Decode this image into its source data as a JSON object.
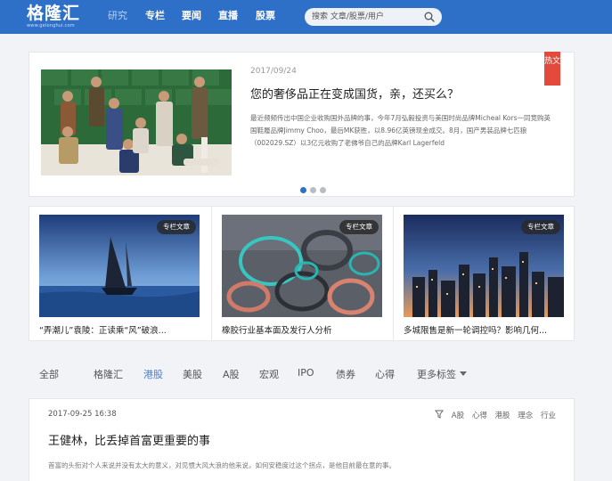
{
  "brand": {
    "name": "格隆汇",
    "domain": "www.gelonghui.com"
  },
  "nav": {
    "items": [
      {
        "label": "研究",
        "active": false
      },
      {
        "label": "专栏",
        "active": true
      },
      {
        "label": "要闻",
        "active": true
      },
      {
        "label": "直播",
        "active": true
      },
      {
        "label": "股票",
        "active": true
      }
    ],
    "search_placeholder": "搜索 文章/股票/用户",
    "search_icon": "search-icon"
  },
  "hero": {
    "date": "2017/09/24",
    "title": "您的奢侈品正在变成国货，亲，还买么？",
    "summary": "最近频频传出中国企业收购国外品牌的事，今年7月弘毅投资与美国时尚品牌Micheal Kors一同竞购英国鞋履品牌Jimmy Choo，最后MK获胜，以8.96亿英镑现金成交。8月，国产男装品牌七匹狼（002029.SZ）以3亿元收购了老佛爷自己的品牌Karl Lagerfeld",
    "badge": "热文",
    "dots_total": 3,
    "dot_active": 0
  },
  "cards": [
    {
      "tag": "专栏文章",
      "title": "“弄潮儿”袁陵：正读乘“风”破浪..."
    },
    {
      "tag": "专栏文章",
      "title": "橡胶行业基本面及发行人分析"
    },
    {
      "tag": "专栏文章",
      "title": "多城限售是新一轮调控吗？影响几何..."
    }
  ],
  "filter_tags": {
    "items": [
      "全部",
      "格隆汇",
      "港股",
      "美股",
      "A股",
      "宏观",
      "IPO",
      "债券",
      "心得"
    ],
    "active_index": 2,
    "more_label": "更多标签"
  },
  "feed": {
    "date": "2017-09-25 16:38",
    "tags": [
      "A股",
      "心得",
      "港股",
      "理念",
      "行业"
    ],
    "title": "王健林，比丢掉首富更重要的事",
    "summary": "首富的头衔对个人来说并没有太大的意义，对见惯大风大浪的他来说，如何安稳度过这个拐点，是他目前最在意的事。"
  },
  "colors": {
    "nav_bg": "#2e6fc7",
    "accent": "#4a7fcc",
    "hot": "#e34a3b"
  }
}
